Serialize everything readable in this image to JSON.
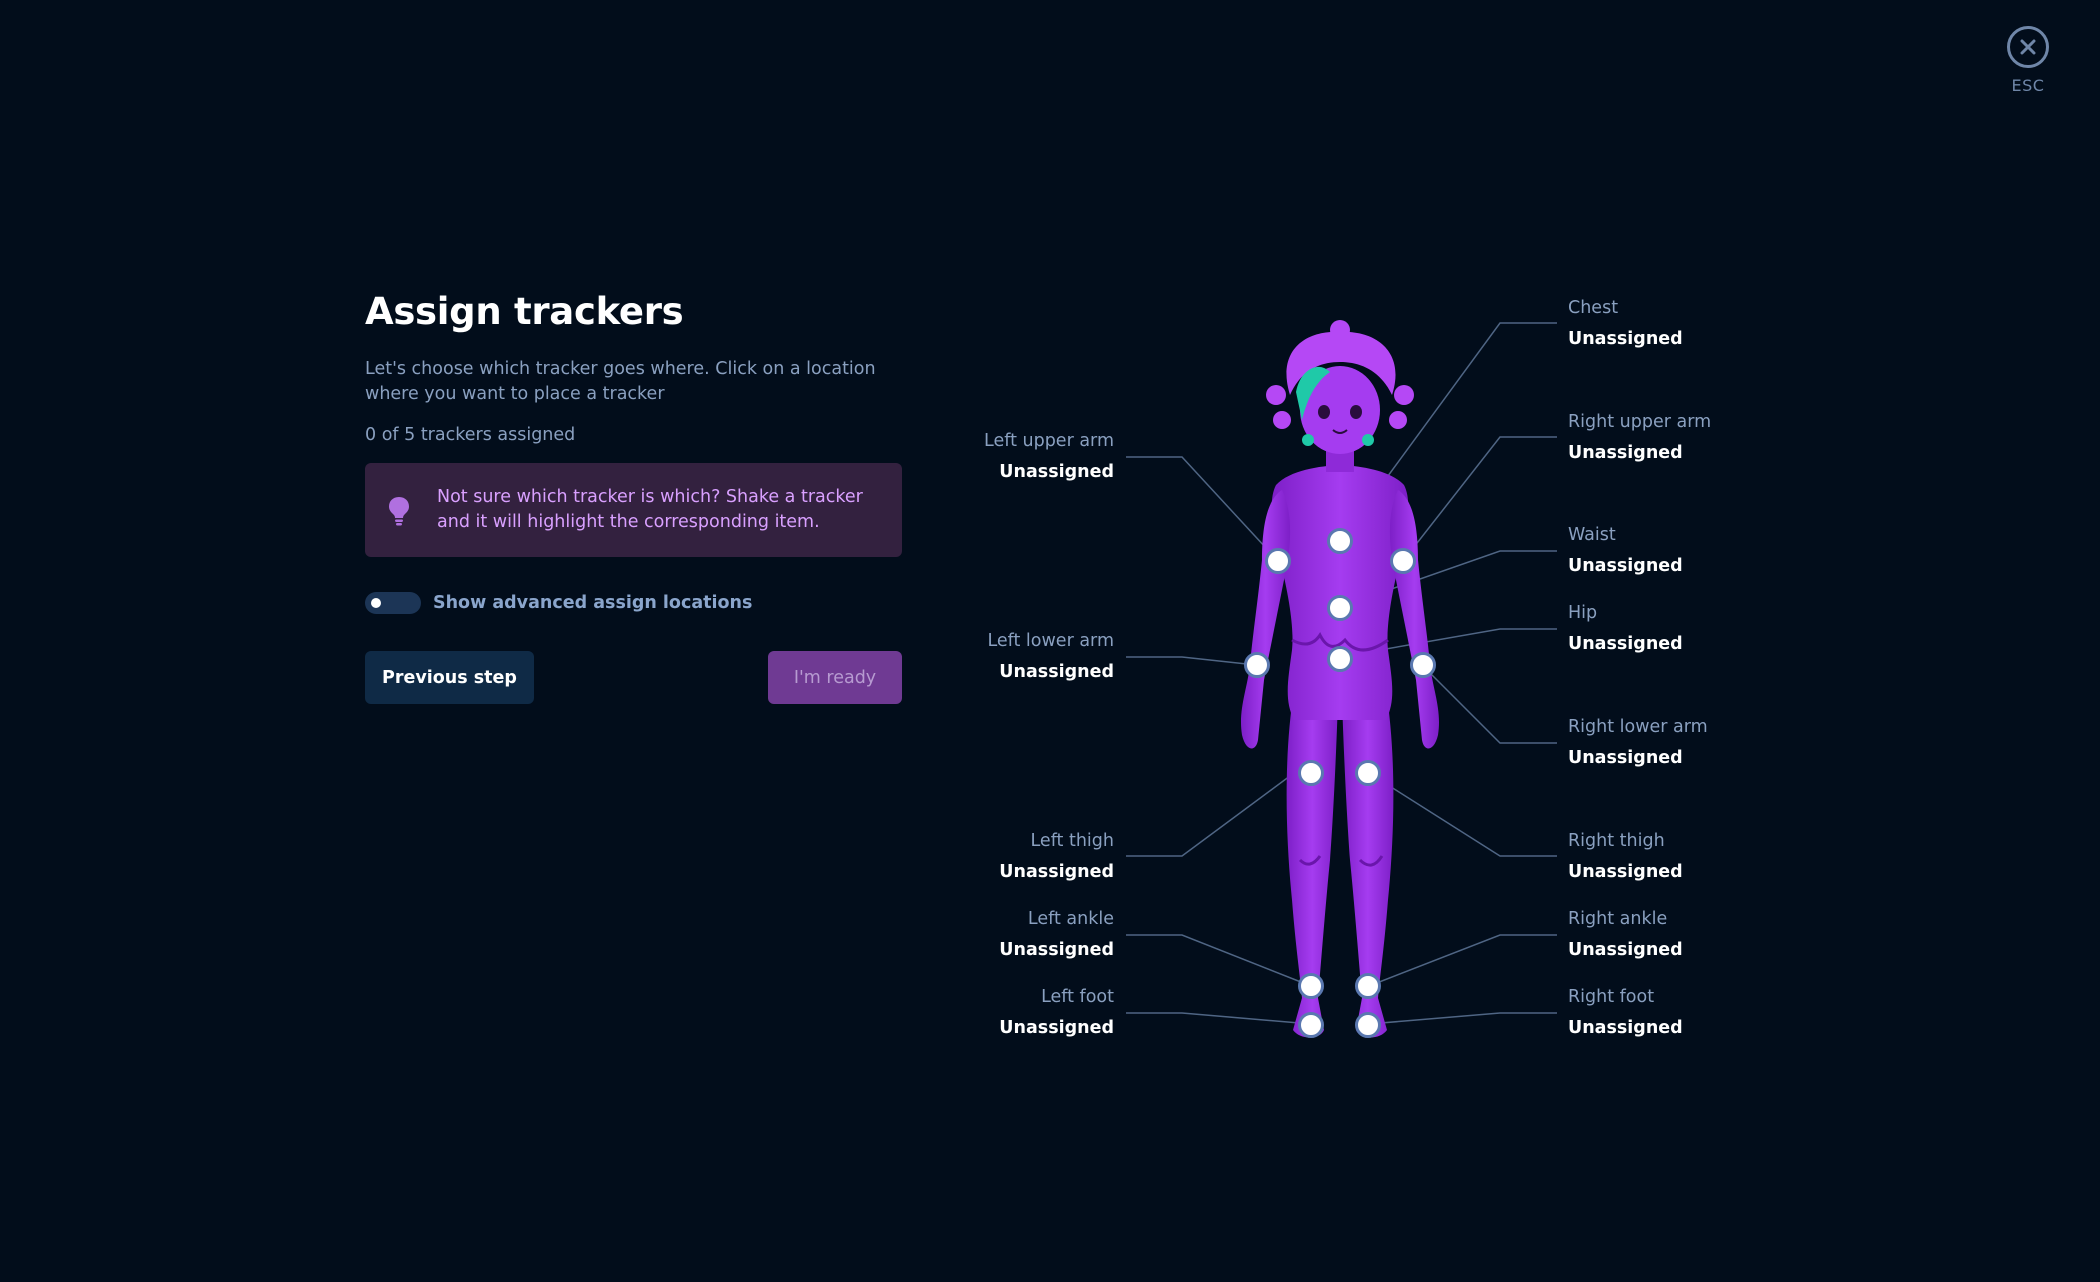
{
  "close": {
    "label": "ESC",
    "icon": "close-icon"
  },
  "heading": "Assign trackers",
  "description": "Let's choose which tracker goes where. Click on a location where you want to place a tracker",
  "tracker_count": "0 of 5 trackers assigned",
  "tip": {
    "icon": "lightbulb-icon",
    "text": "Not sure which tracker is which? Shake a tracker and it will highlight the corresponding item."
  },
  "advanced_toggle": {
    "label": "Show advanced assign locations",
    "enabled": false
  },
  "buttons": {
    "previous": "Previous step",
    "ready": "I'm ready"
  },
  "colors": {
    "background": "#020d1b",
    "accent": "#9b30e8",
    "tip_text": "#d9a0ff",
    "ready_button": "#6f3a93",
    "hair_teal": "#1fc9a8"
  },
  "body_parts": {
    "left": [
      {
        "id": "left-upper-arm",
        "name": "Left upper arm",
        "value": "Unassigned"
      },
      {
        "id": "left-lower-arm",
        "name": "Left lower arm",
        "value": "Unassigned"
      },
      {
        "id": "left-thigh",
        "name": "Left thigh",
        "value": "Unassigned"
      },
      {
        "id": "left-ankle",
        "name": "Left ankle",
        "value": "Unassigned"
      },
      {
        "id": "left-foot",
        "name": "Left foot",
        "value": "Unassigned"
      }
    ],
    "right": [
      {
        "id": "chest",
        "name": "Chest",
        "value": "Unassigned"
      },
      {
        "id": "right-upper-arm",
        "name": "Right upper arm",
        "value": "Unassigned"
      },
      {
        "id": "waist",
        "name": "Waist",
        "value": "Unassigned"
      },
      {
        "id": "hip",
        "name": "Hip",
        "value": "Unassigned"
      },
      {
        "id": "right-lower-arm",
        "name": "Right lower arm",
        "value": "Unassigned"
      },
      {
        "id": "right-thigh",
        "name": "Right thigh",
        "value": "Unassigned"
      },
      {
        "id": "right-ankle",
        "name": "Right ankle",
        "value": "Unassigned"
      },
      {
        "id": "right-foot",
        "name": "Right foot",
        "value": "Unassigned"
      }
    ]
  }
}
